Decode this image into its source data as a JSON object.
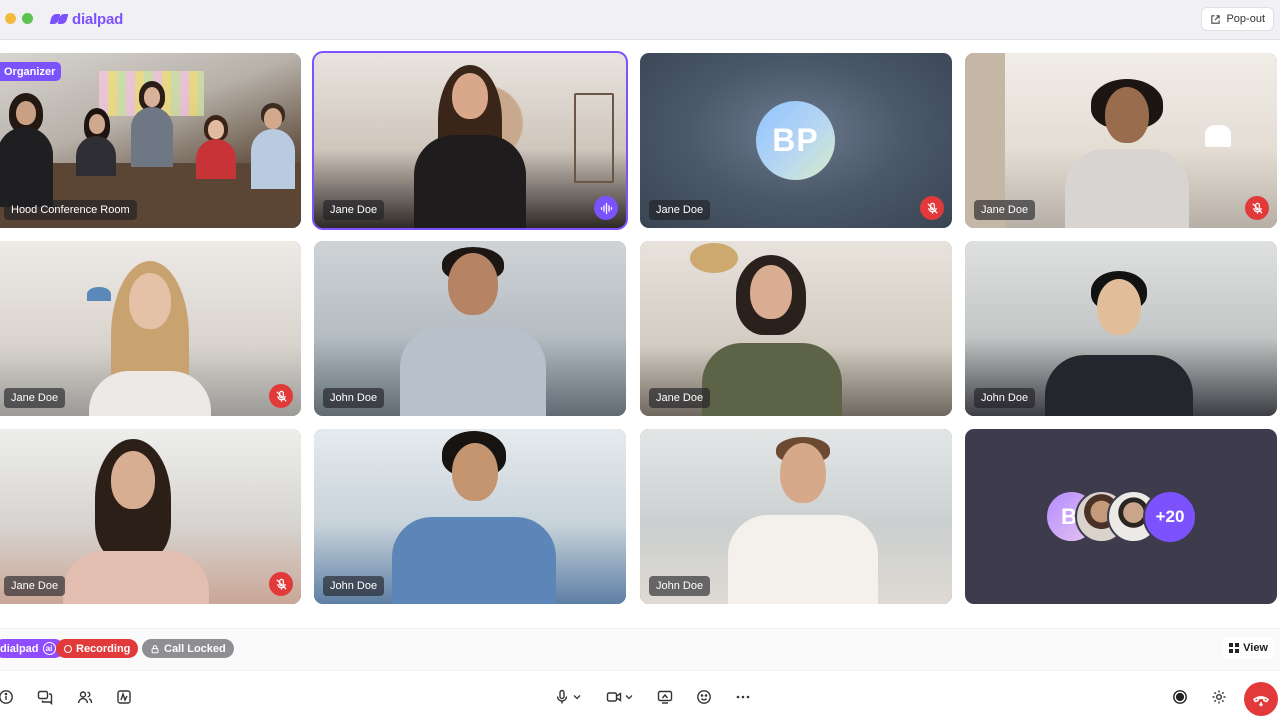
{
  "app": {
    "brand": "dialpad",
    "popout_label": "Pop-out"
  },
  "colors": {
    "accent": "#7c52ff",
    "danger": "#e23a3a",
    "locked": "#8e8e93"
  },
  "tiles": [
    {
      "name": "Hood Conference Room",
      "badge": "Organizer",
      "muted": false,
      "speaking": false
    },
    {
      "name": "Jane Doe",
      "muted": false,
      "speaking": true,
      "active": true
    },
    {
      "name": "Jane Doe",
      "initials": "BP",
      "muted": true,
      "speaking": false
    },
    {
      "name": "Jane Doe",
      "muted": true,
      "speaking": false
    },
    {
      "name": "Jane Doe",
      "muted": true,
      "speaking": false
    },
    {
      "name": "John Doe",
      "muted": false,
      "speaking": false
    },
    {
      "name": "Jane Doe",
      "muted": false,
      "speaking": false
    },
    {
      "name": "John Doe",
      "muted": false,
      "speaking": false
    },
    {
      "name": "Jane Doe",
      "muted": true,
      "speaking": false
    },
    {
      "name": "John Doe",
      "muted": false,
      "speaking": false
    },
    {
      "name": "John Doe",
      "muted": false,
      "speaking": false
    }
  ],
  "overflow": {
    "first_initial": "B",
    "more_count": "+20"
  },
  "status": {
    "ai_label": "dialpad",
    "ai_icon": "ai",
    "recording_label": "Recording",
    "locked_label": "Call Locked",
    "view_label": "View"
  },
  "toolbar": {
    "left_icons": [
      "info-icon",
      "chat-icon",
      "participants-icon",
      "notes-icon"
    ],
    "center_icons": [
      "microphone-icon",
      "camera-icon",
      "share-screen-icon",
      "emoji-icon",
      "more-icon"
    ],
    "right_icons": [
      "record-icon",
      "settings-icon",
      "hang-up-icon"
    ]
  }
}
